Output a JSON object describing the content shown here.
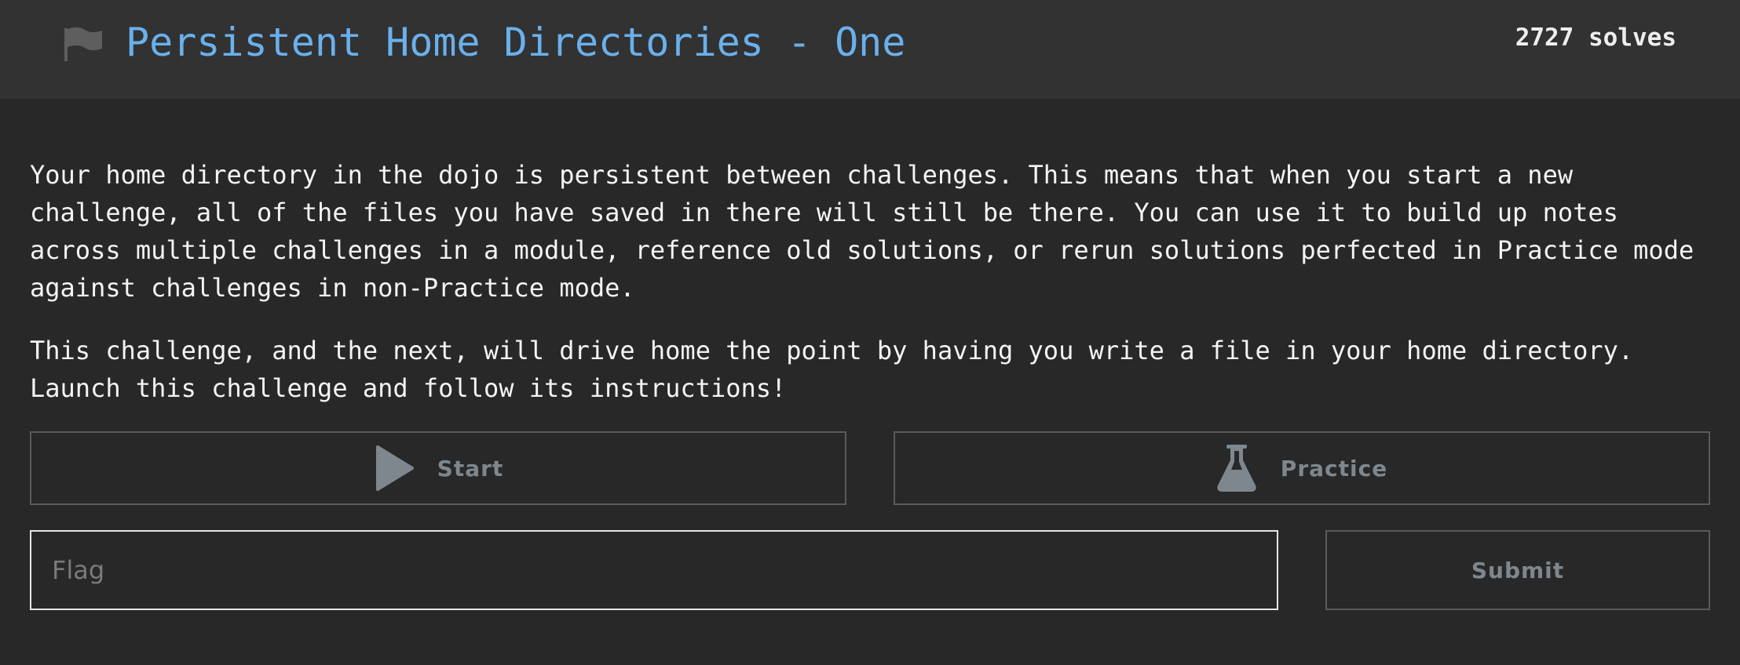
{
  "header": {
    "flag_icon": "flag-icon",
    "title": "Persistent Home Directories - One",
    "solves": "2727 solves"
  },
  "description": {
    "paragraph1": "Your home directory in the dojo is persistent between challenges. This means that when you start a new\nchallenge, all of the files you have saved in there will still be there. You can use it to build up notes\nacross multiple challenges in a module, reference old solutions, or rerun solutions perfected in Practice mode\nagainst challenges in non-Practice mode.",
    "paragraph2": "This challenge, and the next, will drive home the point by having you write a file in your home directory.\nLaunch this challenge and follow its instructions!"
  },
  "actions": {
    "start_label": "Start",
    "start_icon": "play-icon",
    "practice_label": "Practice",
    "practice_icon": "flask-icon"
  },
  "flag_form": {
    "placeholder": "Flag",
    "value": "",
    "submit_label": "Submit"
  },
  "colors": {
    "background": "#282828",
    "header_background": "#323232",
    "title": "#6ab0ec",
    "button_text": "#7f878e"
  }
}
